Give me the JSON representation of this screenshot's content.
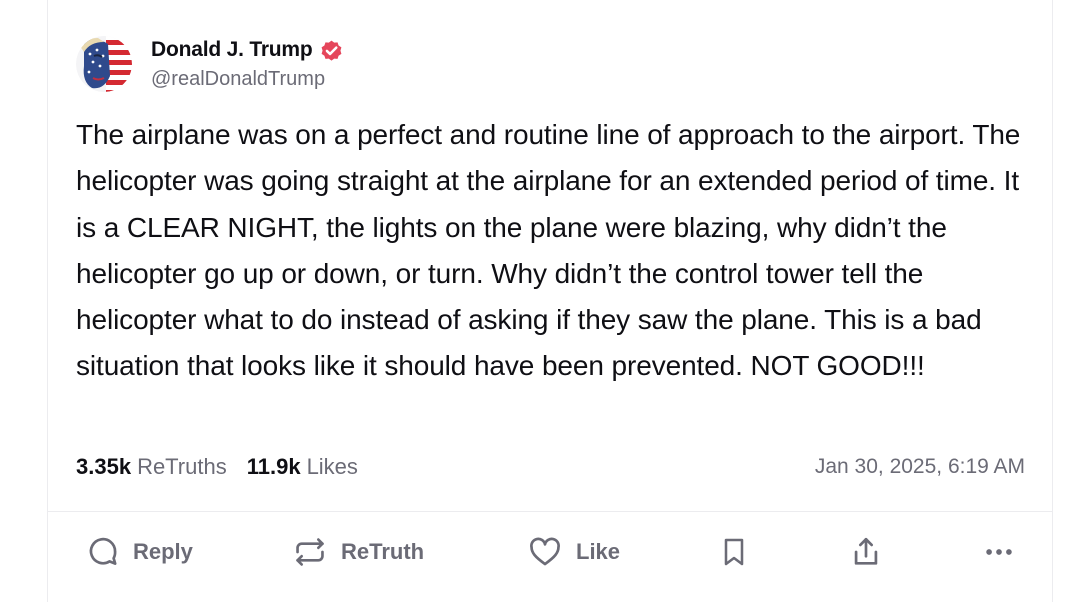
{
  "author": {
    "display_name": "Donald J. Trump",
    "handle": "@realDonaldTrump",
    "verified": true,
    "verified_color": "#e5465b",
    "avatar_icon": "profile-avatar-flag"
  },
  "post": {
    "text": "The airplane was on a perfect and routine line of approach to the airport. The helicopter was going straight at the airplane for an extended period of time. It is a CLEAR NIGHT, the lights on the plane were blazing, why didn’t the helicopter go up or down, or turn. Why didn’t the control tower tell the helicopter what to do instead of asking if they saw the plane. This is a bad situation that looks like it should have been prevented. NOT GOOD!!!",
    "timestamp": "Jan 30, 2025, 6:19 AM"
  },
  "stats": {
    "retruths_count": "3.35k",
    "retruths_label": "ReTruths",
    "likes_count": "11.9k",
    "likes_label": "Likes"
  },
  "actions": {
    "reply": "Reply",
    "retruth": "ReTruth",
    "like": "Like",
    "bookmark_icon": "bookmark-icon",
    "share_icon": "share-icon",
    "more_icon": "more-icon"
  },
  "colors": {
    "text": "#0f0f14",
    "muted": "#6b6b76",
    "border": "#ececef"
  }
}
